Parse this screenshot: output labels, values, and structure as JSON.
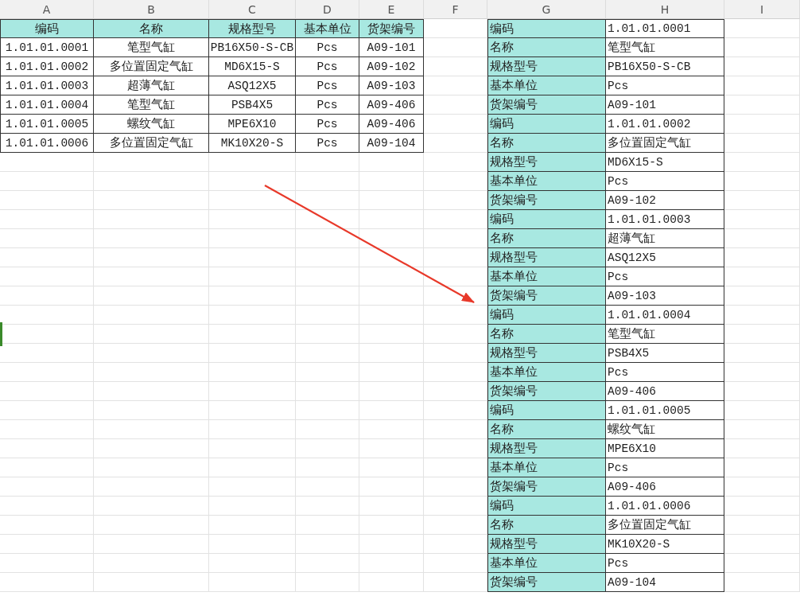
{
  "column_headers": [
    "A",
    "B",
    "C",
    "D",
    "E",
    "F",
    "G",
    "H",
    "I"
  ],
  "left_table": {
    "columns": [
      "编码",
      "名称",
      "规格型号",
      "基本单位",
      "货架编号"
    ],
    "rows": [
      [
        "1.01.01.0001",
        "笔型气缸",
        "PB16X50-S-CB",
        "Pcs",
        "A09-101"
      ],
      [
        "1.01.01.0002",
        "多位置固定气缸",
        "MD6X15-S",
        "Pcs",
        "A09-102"
      ],
      [
        "1.01.01.0003",
        "超薄气缸",
        "ASQ12X5",
        "Pcs",
        "A09-103"
      ],
      [
        "1.01.01.0004",
        "笔型气缸",
        "PSB4X5",
        "Pcs",
        "A09-406"
      ],
      [
        "1.01.01.0005",
        "螺纹气缸",
        "MPE6X10",
        "Pcs",
        "A09-406"
      ],
      [
        "1.01.01.0006",
        "多位置固定气缸",
        "MK10X20-S",
        "Pcs",
        "A09-104"
      ]
    ]
  },
  "right_table": {
    "rows": [
      {
        "label": "编码",
        "value": "1.01.01.0001"
      },
      {
        "label": "名称",
        "value": "笔型气缸"
      },
      {
        "label": "规格型号",
        "value": "PB16X50-S-CB"
      },
      {
        "label": "基本单位",
        "value": "Pcs"
      },
      {
        "label": "货架编号",
        "value": "A09-101"
      },
      {
        "label": "编码",
        "value": "1.01.01.0002"
      },
      {
        "label": "名称",
        "value": "多位置固定气缸"
      },
      {
        "label": "规格型号",
        "value": "MD6X15-S"
      },
      {
        "label": "基本单位",
        "value": "Pcs"
      },
      {
        "label": "货架编号",
        "value": "A09-102"
      },
      {
        "label": "编码",
        "value": "1.01.01.0003"
      },
      {
        "label": "名称",
        "value": "超薄气缸"
      },
      {
        "label": "规格型号",
        "value": "ASQ12X5"
      },
      {
        "label": "基本单位",
        "value": "Pcs"
      },
      {
        "label": "货架编号",
        "value": "A09-103"
      },
      {
        "label": "编码",
        "value": "1.01.01.0004"
      },
      {
        "label": "名称",
        "value": "笔型气缸"
      },
      {
        "label": "规格型号",
        "value": "PSB4X5"
      },
      {
        "label": "基本单位",
        "value": "Pcs"
      },
      {
        "label": "货架编号",
        "value": "A09-406"
      },
      {
        "label": "编码",
        "value": "1.01.01.0005"
      },
      {
        "label": "名称",
        "value": "螺纹气缸"
      },
      {
        "label": "规格型号",
        "value": "MPE6X10"
      },
      {
        "label": "基本单位",
        "value": "Pcs"
      },
      {
        "label": "货架编号",
        "value": "A09-406"
      },
      {
        "label": "编码",
        "value": "1.01.01.0006"
      },
      {
        "label": "名称",
        "value": "多位置固定气缸"
      },
      {
        "label": "规格型号",
        "value": "MK10X20-S"
      },
      {
        "label": "基本单位",
        "value": "Pcs"
      },
      {
        "label": "货架编号",
        "value": "A09-104"
      }
    ]
  }
}
